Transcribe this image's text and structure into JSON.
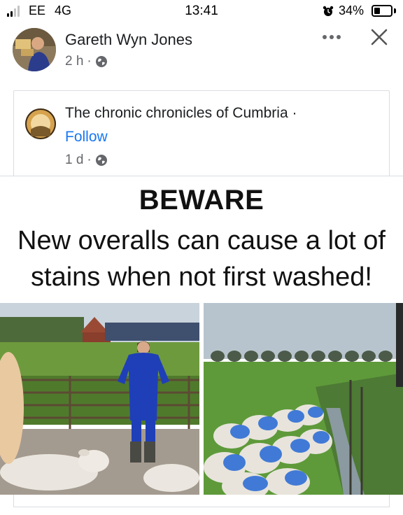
{
  "status_bar": {
    "carrier": "EE",
    "network": "4G",
    "time": "13:41",
    "battery": "34%",
    "battery_level": 0.34,
    "signal_bars_filled": 2,
    "signal_bars_total": 4
  },
  "post": {
    "author": "Gareth Wyn Jones",
    "time": "2 h",
    "separator": "·",
    "audience_icon": "globe-icon",
    "more_icon": "more-dots-icon",
    "close_icon": "close-icon"
  },
  "shared_post": {
    "page_name": "The chronic chronicles of Cumbria ·",
    "follow_label": "Follow",
    "time": "1 d",
    "separator": "·",
    "audience_icon": "globe-icon"
  },
  "meme": {
    "headline": "BEWARE",
    "caption": "New overalls can cause a lot of stains when not first washed!"
  },
  "colors": {
    "link_blue": "#1877f2",
    "meta_grey": "#65676b",
    "overalls_blue": "#1f3fb8",
    "sheep_dye": "#2f6fd6"
  }
}
